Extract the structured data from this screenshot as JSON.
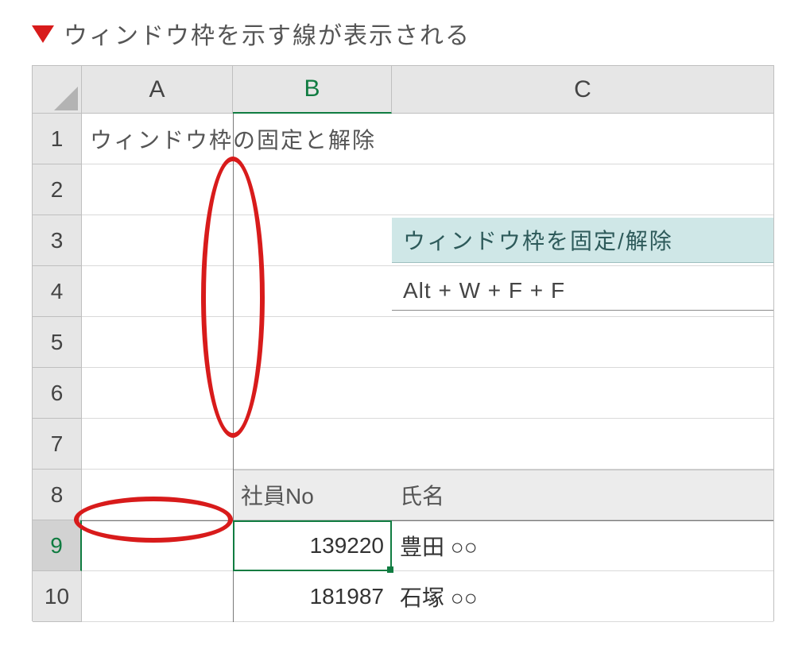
{
  "caption": "ウィンドウ枠を示す線が表示される",
  "columns": {
    "A": "A",
    "B": "B",
    "C": "C"
  },
  "rowNumbers": [
    "1",
    "2",
    "3",
    "4",
    "5",
    "6",
    "7",
    "8",
    "9",
    "10"
  ],
  "cells": {
    "A1": "ウィンドウ枠の固定と解除",
    "C3_title": "ウィンドウ枠を固定/解除",
    "C4_body": "Alt + W + F + F",
    "B8": "社員No",
    "C8": "氏名",
    "B9": "139220",
    "C9": "豊田 ○○",
    "B10": "181987",
    "C10": "石塚 ○○"
  },
  "activeCell": "B9",
  "activeRow": 9,
  "activeCol": "B",
  "freeze": {
    "row": 8,
    "col": "A"
  }
}
